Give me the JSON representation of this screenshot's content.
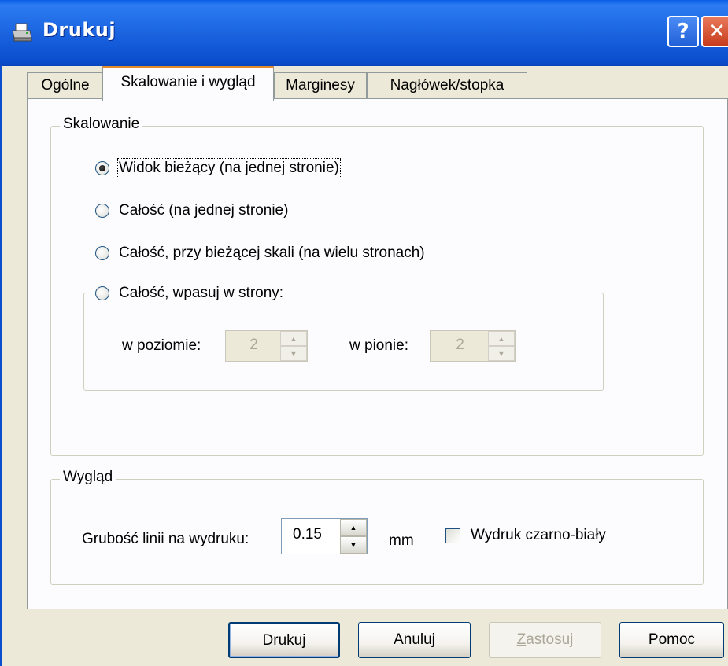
{
  "window": {
    "title": "Drukuj"
  },
  "titlebar_buttons": {
    "help": "?",
    "close": "✕"
  },
  "tabs": [
    {
      "label": "Ogólne"
    },
    {
      "label": "Skalowanie i wygląd",
      "active": true
    },
    {
      "label": "Marginesy"
    },
    {
      "label": "Nagłówek/stopka"
    }
  ],
  "scaling": {
    "group_label": "Skalowanie",
    "options": [
      {
        "label": "Widok bieżący (na jednej stronie)",
        "checked": true
      },
      {
        "label": "Całość (na jednej stronie)",
        "checked": false
      },
      {
        "label": "Całość, przy bieżącej skali (na wielu stronach)",
        "checked": false
      },
      {
        "label": "Całość, wpasuj w strony:",
        "checked": false
      }
    ],
    "fit": {
      "horizontal_label": "w poziomie:",
      "horizontal_value": "2",
      "vertical_label": "w pionie:",
      "vertical_value": "2"
    }
  },
  "appearance": {
    "group_label": "Wygląd",
    "line_width_label": "Grubość linii na wydruku:",
    "line_width_value": "0.15",
    "unit": "mm",
    "bw_label": "Wydruk czarno-biały",
    "bw_checked": false
  },
  "buttons": {
    "print": "Drukuj",
    "print_mnemonic": "D",
    "print_rest": "rukuj",
    "cancel": "Anuluj",
    "apply_mnemonic": "Z",
    "apply_rest": "astosuj",
    "help": "Pomoc"
  }
}
